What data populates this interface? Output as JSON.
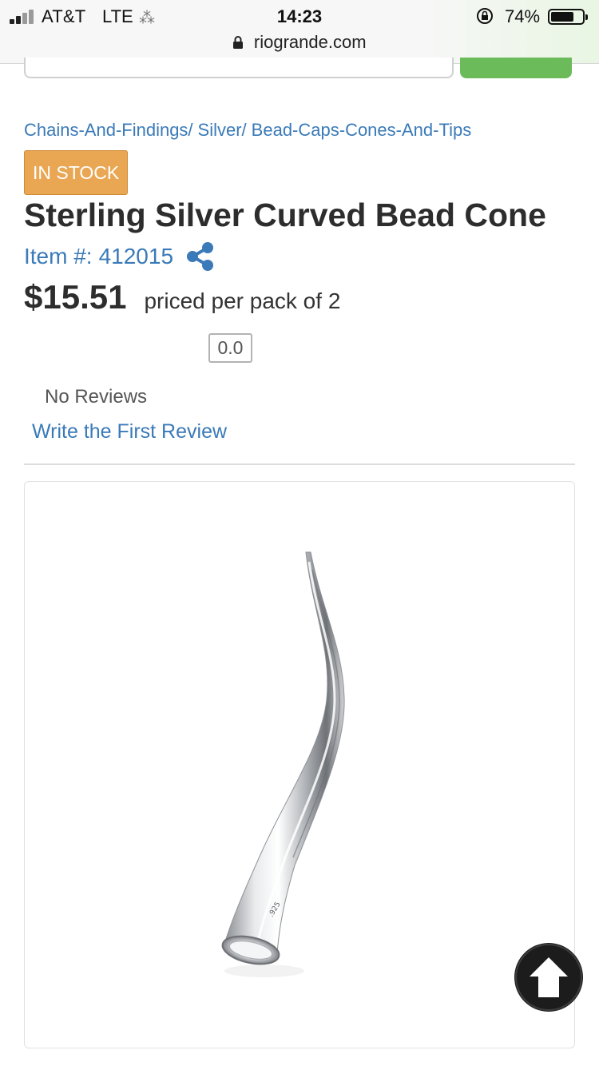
{
  "status_bar": {
    "carrier": "AT&T",
    "network": "LTE",
    "time": "14:23",
    "battery_percent": "74%",
    "battery_level": 0.74
  },
  "browser": {
    "url": "riogrande.com"
  },
  "breadcrumb": [
    {
      "label": "Chains-And-Findings/"
    },
    {
      "label": "Silver/"
    },
    {
      "label": "Bead-Caps-Cones-And-Tips"
    }
  ],
  "product": {
    "stock_status": "IN STOCK",
    "title": "Sterling Silver Curved Bead Cone",
    "item_label": "Item #:",
    "item_number": "412015",
    "price": "$15.51",
    "price_note": "priced per pack of 2",
    "rating": "0.0",
    "reviews_text": "No Reviews",
    "write_review_link": "Write the First Review"
  },
  "colors": {
    "link": "#3a7ab8",
    "badge": "#e9a753",
    "search_button": "#6cbb5a",
    "back_to_top": "#1c1c1c"
  },
  "icons": {
    "share": "share-icon",
    "back_to_top": "arrow-up-icon",
    "url_lock": "lock-icon"
  }
}
